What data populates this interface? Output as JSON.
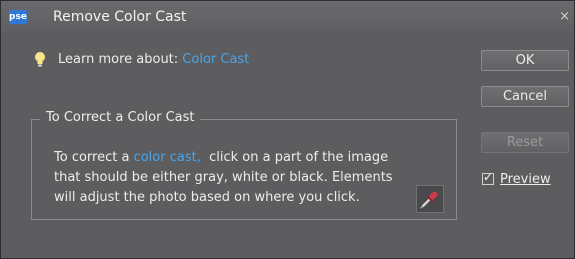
{
  "window": {
    "app_icon_text": "pse",
    "title": "Remove Color Cast",
    "close_glyph": "×"
  },
  "learn_more": {
    "prefix": "Learn more about: ",
    "link_text": "Color Cast"
  },
  "group": {
    "legend": "To Correct a Color Cast",
    "line1_prefix": "To correct a ",
    "line1_link": "color cast,",
    "line1_suffix": "  click on a part of the image",
    "line2": "that should be either gray, white or black. Elements",
    "line3": "will adjust the photo based on where you click."
  },
  "buttons": {
    "ok": "OK",
    "cancel": "Cancel",
    "reset": "Reset"
  },
  "preview": {
    "label": "Preview",
    "checked": true
  },
  "colors": {
    "dialog_bg": "#5d5d5f",
    "link": "#4aa3ea",
    "text": "#ededed"
  },
  "icons": [
    "lightbulb-icon",
    "eyedropper-icon",
    "close-icon",
    "app-icon"
  ]
}
